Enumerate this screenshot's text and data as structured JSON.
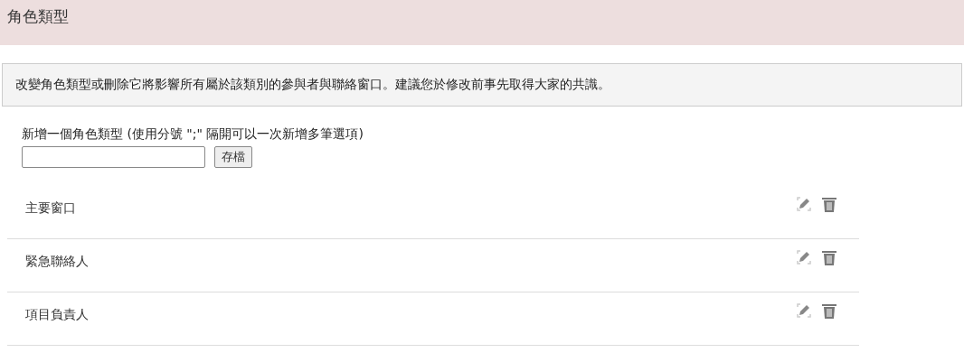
{
  "header": {
    "title": "角色類型"
  },
  "notice": "改變角色類型或刪除它將影響所有屬於該類別的參與者與聯絡窗口。建議您於修改前事先取得大家的共識。",
  "add_form": {
    "label": "新增一個角色類型  (使用分號 \";\" 隔開可以一次新增多筆選項)",
    "save_button": "存檔"
  },
  "roles": [
    {
      "name": "主要窗口"
    },
    {
      "name": "緊急聯絡人"
    },
    {
      "name": "項目負責人"
    }
  ]
}
